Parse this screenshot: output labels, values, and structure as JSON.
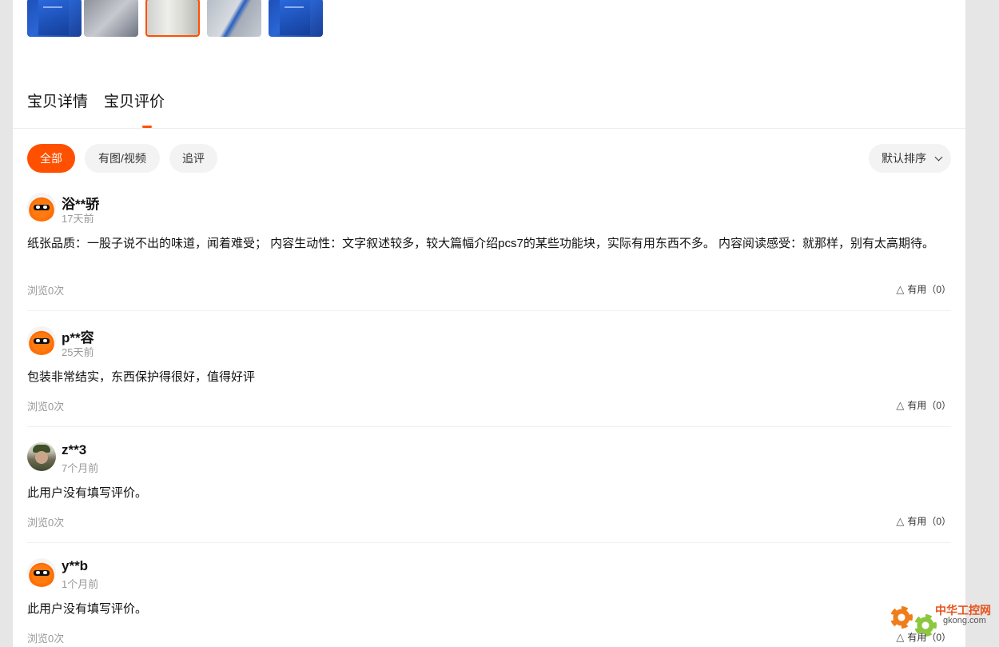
{
  "tabs": [
    {
      "label": "宝贝详情"
    },
    {
      "label": "宝贝评价"
    }
  ],
  "filters": [
    {
      "label": "全部"
    },
    {
      "label": "有图/视频"
    },
    {
      "label": "追评"
    }
  ],
  "sort": {
    "label": "默认排序"
  },
  "reviews": [
    {
      "user": "浴**骄",
      "time": "17天前",
      "content": "纸张品质：一股子说不出的味道，闻着难受； 内容生动性：文字叙述较多，较大篇幅介绍pcs7的某些功能块，实际有用东西不多。 内容阅读感受：就那样，别有太高期待。",
      "views": "浏览0次",
      "useful": "有用（0）"
    },
    {
      "user": "p**容",
      "time": "25天前",
      "content": "包装非常结实，东西保护得很好，值得好评",
      "views": "浏览0次",
      "useful": "有用（0）"
    },
    {
      "user": "z**3",
      "time": "7个月前",
      "content": "此用户没有填写评价。",
      "views": "浏览0次",
      "useful": "有用（0）"
    },
    {
      "user": "y**b",
      "time": "1个月前",
      "content": "此用户没有填写评价。",
      "views": "浏览0次",
      "useful": "有用（0）"
    }
  ],
  "watermark": {
    "cn": "中华工控网",
    "en": "gkong.com"
  },
  "colors": {
    "accent": "#ff5000"
  }
}
